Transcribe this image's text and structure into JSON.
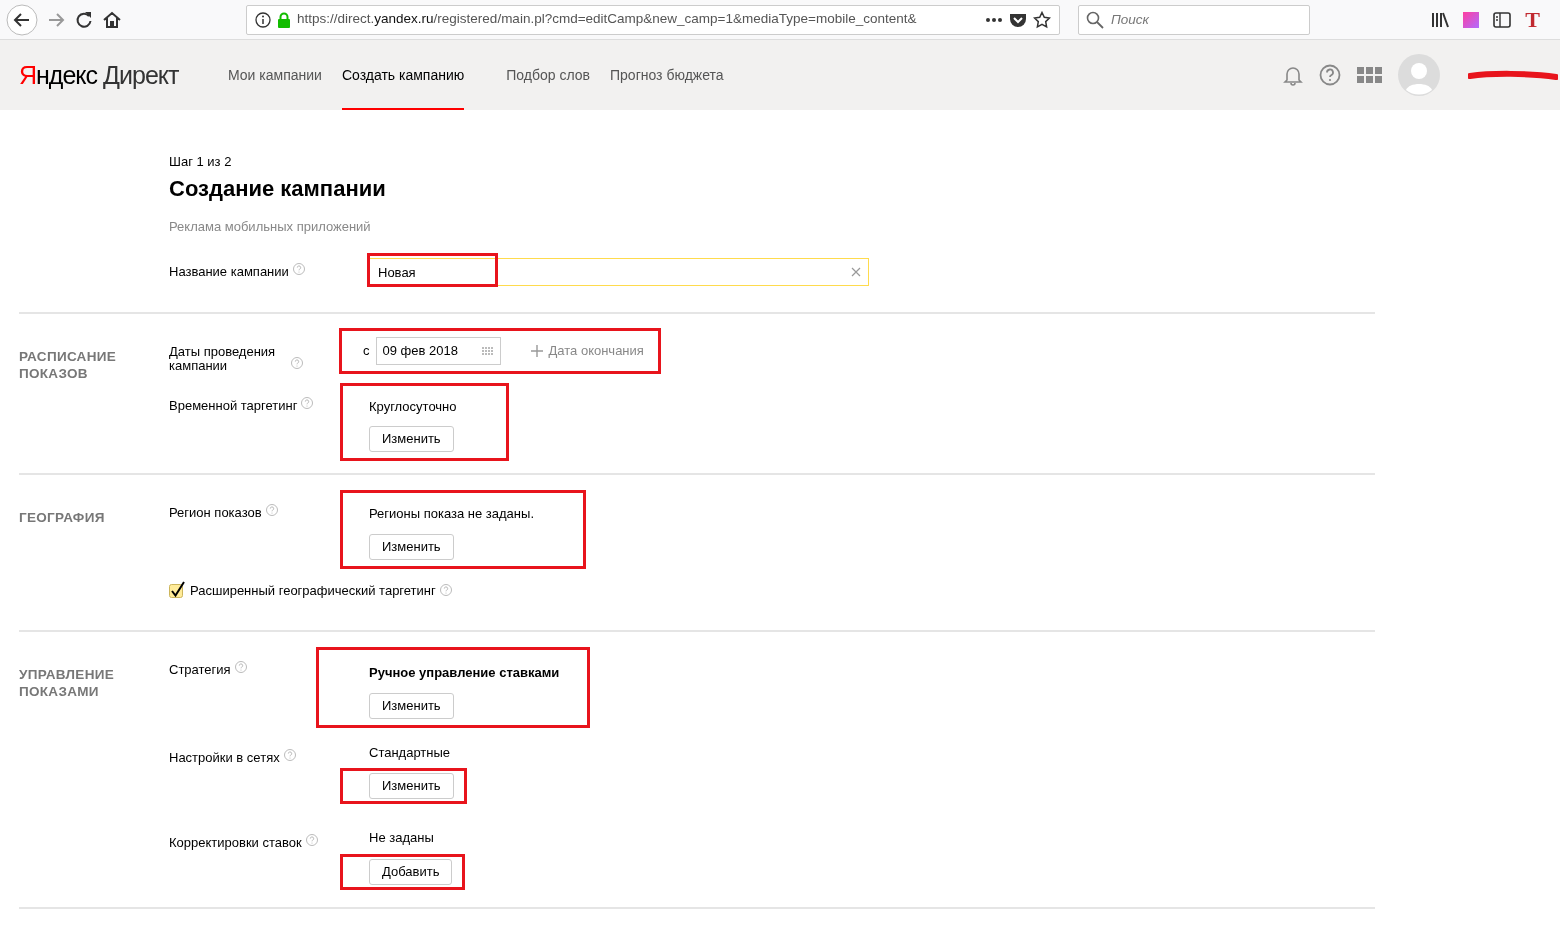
{
  "browser": {
    "url": {
      "host_start": "https://direct.",
      "domain": "yandex.ru",
      "path": "/registered/main.pl?cmd=editCamp&new_camp=1&mediaType=mobile_content&"
    },
    "search_placeholder": "Поиск",
    "extension_glyph": "T"
  },
  "header": {
    "logo": {
      "brand": "Яндекс",
      "product": "Директ"
    },
    "nav": [
      {
        "label": "Мои кампании",
        "selected": false
      },
      {
        "label": "Создать кампанию",
        "selected": true
      },
      {
        "label": "Подбор слов",
        "selected": false
      },
      {
        "label": "Прогноз бюджета",
        "selected": false
      }
    ]
  },
  "page": {
    "step": "Шаг 1 из 2",
    "title": "Создание кампании",
    "subtitle": "Реклама мобильных приложений"
  },
  "name_field": {
    "label": "Название кампании",
    "value": "Новая",
    "highlighted": true
  },
  "sections": [
    {
      "title": "РАСПИСАНИЕ ПОКАЗОВ",
      "rows": [
        {
          "kind": "dates",
          "label": "Даты проведения кампании",
          "prefix": "с",
          "date": "09 фев 2018",
          "add_link": "Дата окончания",
          "highlighted": true
        },
        {
          "kind": "value",
          "label": "Временной таргетинг",
          "value": "Круглосуточно",
          "bold": false,
          "button": "Изменить",
          "highlighted": true,
          "button_highlighted": false
        }
      ]
    },
    {
      "title": "ГЕОГРАФИЯ",
      "rows": [
        {
          "kind": "value",
          "label": "Регион показов",
          "value": "Регионы показа не заданы.",
          "bold": false,
          "button": "Изменить",
          "highlighted": true,
          "button_highlighted": false
        },
        {
          "kind": "checkbox",
          "label": "Расширенный географический таргетинг",
          "checked": true
        }
      ]
    },
    {
      "title": "УПРАВЛЕНИЕ ПОКАЗАМИ",
      "rows": [
        {
          "kind": "value",
          "label": "Стратегия",
          "value": "Ручное управление ставками",
          "bold": true,
          "button": "Изменить",
          "highlighted": true,
          "button_highlighted": false
        },
        {
          "kind": "value",
          "label": "Настройки в сетях",
          "value": "Стандартные",
          "bold": false,
          "button": "Изменить",
          "highlighted": false,
          "button_highlighted": true
        },
        {
          "kind": "value",
          "label": "Корректировки ставок",
          "value": "Не заданы",
          "bold": false,
          "button": "Добавить",
          "highlighted": false,
          "button_highlighted": true
        }
      ]
    }
  ]
}
